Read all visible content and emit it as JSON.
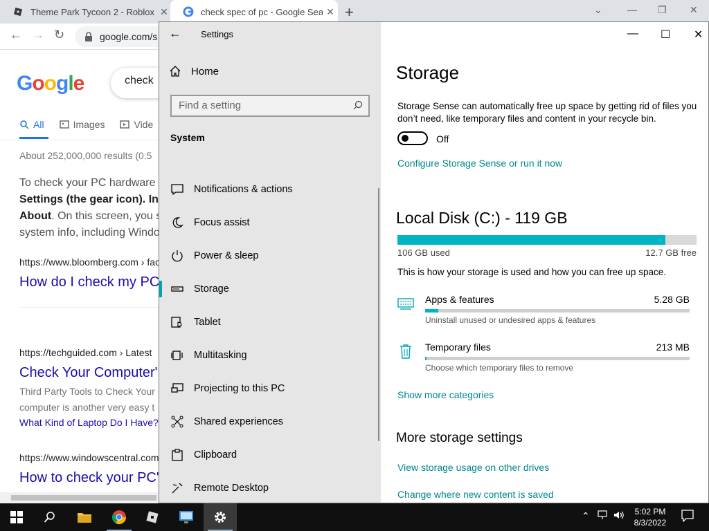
{
  "chrome": {
    "tabs": [
      {
        "title": "Theme Park Tycoon 2 - Roblox"
      },
      {
        "title": "check spec of pc - Google Search"
      }
    ],
    "url": "google.com/s",
    "search_query": "check",
    "gtabs": {
      "all": "All",
      "images": "Images",
      "videos": "Vide"
    },
    "results_count": "About 252,000,000 results (0.5",
    "snippet": {
      "line1": "To check your PC hardware",
      "line2": "Settings (the gear icon). In t",
      "line3": "About. On this screen, you s",
      "line4": "system info, including Windo"
    },
    "results": [
      {
        "cite": "https://www.bloomberg.com › fac",
        "title": "How do I check my PC"
      },
      {
        "cite": "https://techguided.com › Latest",
        "title": "Check Your Computer'",
        "snippet1": "Third Party Tools to Check Your",
        "snippet2": "computer is another very easy t",
        "sublink": "What Kind of Laptop Do I Have?"
      },
      {
        "cite": "https://www.windowscentral.com",
        "title": "How to check your PC'"
      }
    ]
  },
  "settings": {
    "title": "Settings",
    "home": "Home",
    "search_placeholder": "Find a setting",
    "section": "System",
    "nav": [
      {
        "label": "Notifications & actions",
        "icon": "notifications-icon"
      },
      {
        "label": "Focus assist",
        "icon": "moon-icon"
      },
      {
        "label": "Power & sleep",
        "icon": "power-icon"
      },
      {
        "label": "Storage",
        "icon": "storage-icon",
        "selected": true
      },
      {
        "label": "Tablet",
        "icon": "tablet-icon"
      },
      {
        "label": "Multitasking",
        "icon": "multitasking-icon"
      },
      {
        "label": "Projecting to this PC",
        "icon": "projector-icon"
      },
      {
        "label": "Shared experiences",
        "icon": "shared-icon"
      },
      {
        "label": "Clipboard",
        "icon": "clipboard-icon"
      },
      {
        "label": "Remote Desktop",
        "icon": "remote-desktop-icon"
      }
    ],
    "storage": {
      "heading": "Storage",
      "description": "Storage Sense can automatically free up space by getting rid of files you don’t need, like temporary files and content in your recycle bin.",
      "toggle_state": "Off",
      "configure_link": "Configure Storage Sense or run it now",
      "disk_heading": "Local Disk (C:) - 119 GB",
      "used_label": "106 GB used",
      "free_label": "12.7 GB free",
      "used_fraction": 0.895,
      "info": "This is how your storage is used and how you can free up space.",
      "categories": [
        {
          "name": "Apps & features",
          "size": "5.28 GB",
          "sub": "Uninstall unused or undesired apps & features",
          "fraction": 0.05
        },
        {
          "name": "Temporary files",
          "size": "213 MB",
          "sub": "Choose which temporary files to remove",
          "fraction": 0.004
        }
      ],
      "show_more": "Show more categories",
      "more_heading": "More storage settings",
      "link_other_drives": "View storage usage on other drives",
      "link_new_content": "Change where new content is saved"
    }
  },
  "taskbar": {
    "time": "5:02 PM",
    "date": "8/3/2022"
  },
  "colors": {
    "accent": "#00b4c4",
    "link": "#00878f",
    "google_link": "#1a0dab"
  }
}
